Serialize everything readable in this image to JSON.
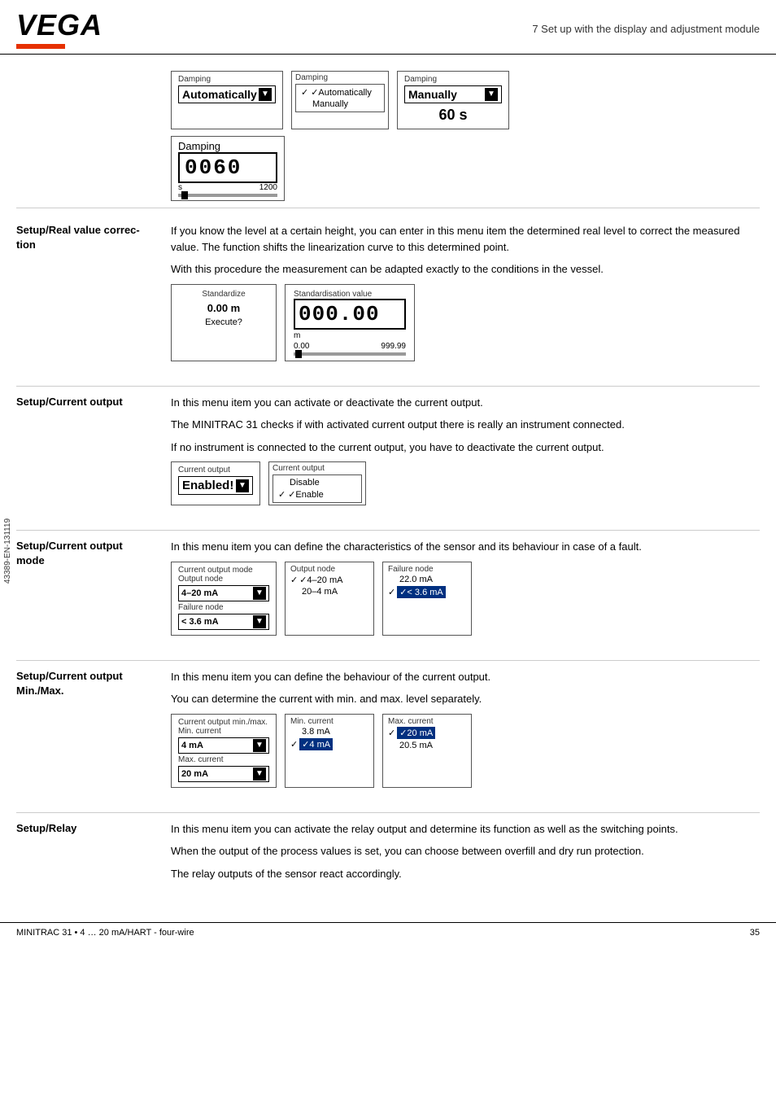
{
  "header": {
    "logo": "VEGA",
    "title": "7 Set up with the display and adjustment module"
  },
  "footer": {
    "left": "MINITRAC 31 • 4 … 20 mA/HART - four-wire",
    "right": "35",
    "side_label": "43389-EN-131119"
  },
  "damping": {
    "section1": {
      "label1": "Damping",
      "value1": "Automatically",
      "menu_label": "Damping",
      "menu_auto": "✓Automatically",
      "menu_manual": "Manually",
      "label2": "Damping",
      "value2": "Manually",
      "sixty_s": "60 s"
    },
    "section2": {
      "label": "Damping",
      "display": "0060",
      "unit": "s",
      "range_max": "1200"
    }
  },
  "real_value": {
    "heading": "Setup/Real value correc-\ntion",
    "text1": "If you know the level at a certain height, you can enter in this menu item the determined real level to correct the measured value. The function shifts the linearization curve to this determined point.",
    "text2": "With this procedure the measurement can be adapted exactly to the conditions in the vessel.",
    "std_label": "Standardize",
    "std_value": "0.00 m",
    "std_execute": "Execute?",
    "std_val_label": "Standardisation value",
    "std_display": "000.00",
    "std_unit": "m",
    "std_min": "0.00",
    "std_max": "999.99"
  },
  "current_output": {
    "heading": "Setup/Current output",
    "text1": "In this menu item you can activate or deactivate the current output.",
    "text2": "The MINITRAC 31 checks if with activated current output there is really an instrument connected.",
    "text3": "If no instrument is connected to the current output, you have to deactivate the current output.",
    "widget_label": "Current output",
    "widget_value": "Enabled!",
    "menu_label": "Current output",
    "menu_disable": "Disable",
    "menu_enable": "✓Enable"
  },
  "current_output_mode": {
    "heading": "Setup/Current output mode",
    "text1": "In this menu item you can define the characteristics of the sensor and its behaviour in case of a fault.",
    "box1_title1": "Current output mode",
    "box1_title2": "Output node",
    "box1_value1": "4–20 mA",
    "box1_title3": "Failure node",
    "box1_value2": "< 3.6 mA",
    "menu_label": "Output node",
    "menu_val1": "✓4–20 mA",
    "menu_val2": "20–4 mA",
    "menu_label2": "Failure node",
    "menu_f1": "22.0 mA",
    "menu_f2": "✓< 3.6 mA"
  },
  "current_output_minmax": {
    "heading": "Setup/Current output Min./Max.",
    "text1": "In this menu item you can define the behaviour of the current output.",
    "text2": "You can determine the current with min. and max. level separately.",
    "box1_title": "Current output min./max.",
    "box1_min_label": "Min. current",
    "box1_min_val": "4 mA",
    "box1_max_label": "Max. current",
    "box1_max_val": "20 mA",
    "menu_min_label": "Min. current",
    "menu_min1": "3.8 mA",
    "menu_min2": "✓4 mA",
    "menu_max_label": "Max. current",
    "menu_max1": "✓20 mA",
    "menu_max2": "20.5 mA"
  },
  "relay": {
    "heading": "Setup/Relay",
    "text1": "In this menu item you can activate the relay output and determine its function as well as the switching points.",
    "text2": "When the output of the process values is set, you can choose between overfill and dry run protection.",
    "text3": "The relay outputs of the sensor react accordingly."
  }
}
